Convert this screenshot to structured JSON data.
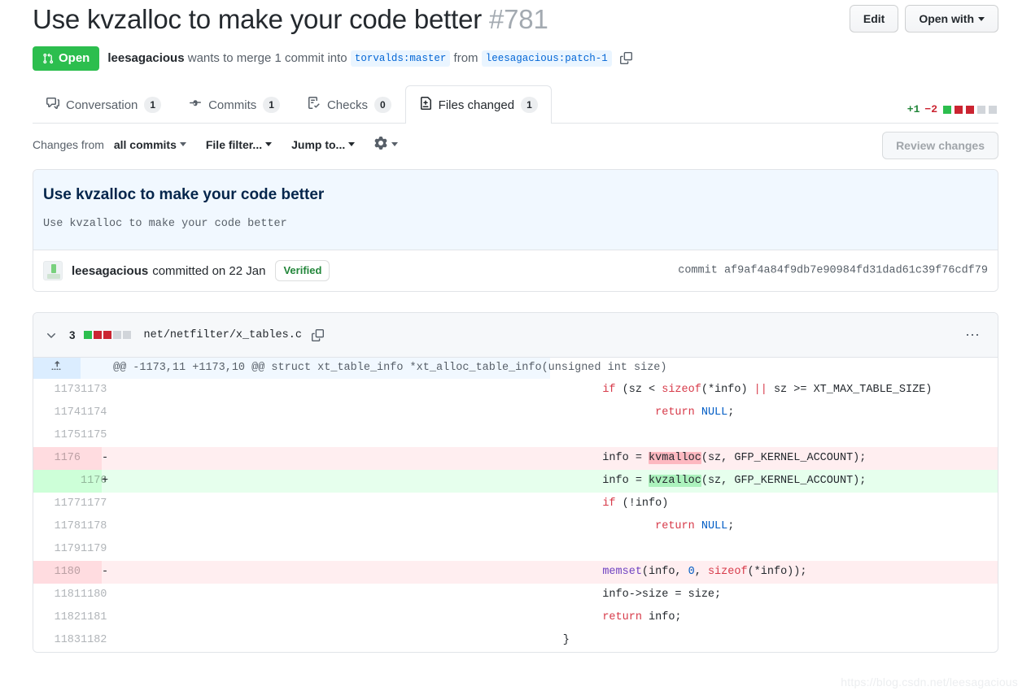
{
  "header": {
    "title": "Use kvzalloc to make your code better",
    "number": "#781",
    "edit_label": "Edit",
    "open_with_label": "Open with",
    "state": "Open",
    "author": "leesagacious",
    "merge_text_1": "wants to merge 1 commit into",
    "base_branch": "torvalds:master",
    "merge_text_2": "from",
    "head_branch": "leesagacious:patch-1"
  },
  "tabs": [
    {
      "label": "Conversation",
      "count": "1",
      "icon": "comment-discussion-icon",
      "active": false
    },
    {
      "label": "Commits",
      "count": "1",
      "icon": "git-commit-icon",
      "active": false
    },
    {
      "label": "Checks",
      "count": "0",
      "icon": "checklist-icon",
      "active": false
    },
    {
      "label": "Files changed",
      "count": "1",
      "icon": "file-diff-icon",
      "active": true
    }
  ],
  "diffstat": {
    "additions": "+1",
    "deletions": "−2",
    "blocks": [
      "a",
      "d",
      "d",
      "n",
      "n"
    ]
  },
  "toolbar": {
    "changes_from_prefix": "Changes from",
    "changes_from_value": "all commits",
    "file_filter": "File filter...",
    "jump_to": "Jump to...",
    "gear_icon": "gear-icon",
    "review_changes": "Review changes"
  },
  "commit": {
    "title": "Use kvzalloc to make your code better",
    "body": "Use kvzalloc to make your code better",
    "author": "leesagacious",
    "committed_text": "committed on 22 Jan",
    "verified": "Verified",
    "sha_label": "commit",
    "sha": "af9af4a84f9db7e90984fd31dad61c39f76cdf79"
  },
  "file": {
    "change_count": "3",
    "blocks": [
      "a",
      "d",
      "d",
      "n",
      "n"
    ],
    "path": "net/netfilter/x_tables.c",
    "copy_icon": "copy-icon",
    "kebab_icon": "kebab-horizontal-icon",
    "chevron_icon": "chevron-down-icon",
    "expand_icon": "unfold-icon"
  },
  "diff": {
    "hunk_header": "@@ -1173,11 +1173,10 @@ struct xt_table_info *xt_alloc_table_info(unsigned int size)",
    "rows": [
      {
        "type": "ctx",
        "old": "1173",
        "new": "1173",
        "marker": "",
        "code": "        <span class=\"kw\">if</span> (sz &lt; <span class=\"kw\">sizeof</span>(*info) <span class=\"kw\">||</span> sz &gt;= XT_MAX_TABLE_SIZE)",
        "text": "        if (sz < sizeof(*info) || sz >= XT_MAX_TABLE_SIZE)"
      },
      {
        "type": "ctx",
        "old": "1174",
        "new": "1174",
        "marker": "",
        "code": "                <span class=\"kw\">return</span> <span class=\"cn\">NULL</span>;",
        "text": "                return NULL;"
      },
      {
        "type": "ctx",
        "old": "1175",
        "new": "1175",
        "marker": "",
        "code": "",
        "text": ""
      },
      {
        "type": "del",
        "old": "1176",
        "new": "",
        "marker": "-",
        "code": "        info = <span class=\"wdel\">kvmalloc</span>(sz, GFP_KERNEL_ACCOUNT);",
        "text": "        info = kvmalloc(sz, GFP_KERNEL_ACCOUNT);"
      },
      {
        "type": "add",
        "old": "",
        "new": "1176",
        "marker": "+",
        "code": "        info = <span class=\"wadd\">kvzalloc</span>(sz, GFP_KERNEL_ACCOUNT);",
        "text": "        info = kvzalloc(sz, GFP_KERNEL_ACCOUNT);"
      },
      {
        "type": "ctx",
        "old": "1177",
        "new": "1177",
        "marker": "",
        "code": "        <span class=\"kw\">if</span> (!info)",
        "text": "        if (!info)"
      },
      {
        "type": "ctx",
        "old": "1178",
        "new": "1178",
        "marker": "",
        "code": "                <span class=\"kw\">return</span> <span class=\"cn\">NULL</span>;",
        "text": "                return NULL;"
      },
      {
        "type": "ctx",
        "old": "1179",
        "new": "1179",
        "marker": "",
        "code": "",
        "text": ""
      },
      {
        "type": "del",
        "old": "1180",
        "new": "",
        "marker": "-",
        "code": "        <span class=\"fn\">memset</span>(info, <span class=\"cn\">0</span>, <span class=\"kw\">sizeof</span>(*info));",
        "text": "        memset(info, 0, sizeof(*info));"
      },
      {
        "type": "ctx",
        "old": "1181",
        "new": "1180",
        "marker": "",
        "code": "        info-&gt;size = size;",
        "text": "        info->size = size;"
      },
      {
        "type": "ctx",
        "old": "1182",
        "new": "1181",
        "marker": "",
        "code": "        <span class=\"kw\">return</span> info;",
        "text": "        return info;"
      },
      {
        "type": "ctx",
        "old": "1183",
        "new": "1182",
        "marker": "",
        "code": "  }",
        "text": "  }"
      }
    ]
  },
  "watermark": "https://blog.csdn.net/leesagacious",
  "colors": {
    "open_green": "#2cbe4e",
    "add_bg": "#e6ffed",
    "del_bg": "#ffeef0",
    "add_word": "#acf2bd",
    "del_word": "#fdb8c0",
    "link_blue": "#0366d6",
    "keyword_red": "#d73a49",
    "constant_blue": "#005cc5",
    "function_purple": "#6f42c1"
  }
}
